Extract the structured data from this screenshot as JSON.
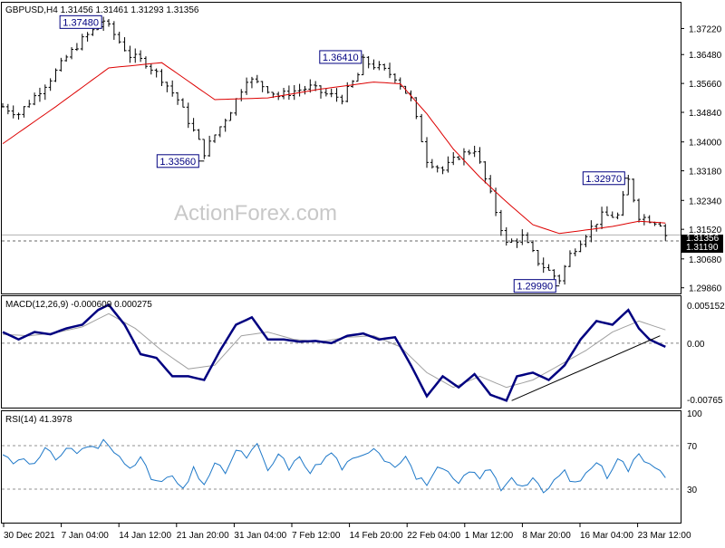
{
  "chart_data": [
    {
      "type": "ohlc",
      "panel": "price",
      "title": "GBPUSD,H4  1.31456 1.31461 1.31293 1.31356",
      "watermark": "ActionForex.com",
      "y_ticks": [
        1.3722,
        1.3648,
        1.3566,
        1.3484,
        1.34,
        1.3318,
        1.3234,
        1.3152,
        1.3068,
        1.2986
      ],
      "y_tick_labels": [
        "1.37220",
        "1.36480",
        "1.35660",
        "1.34840",
        "1.34000",
        "1.33180",
        "1.32340",
        "1.31520",
        "1.30680",
        "1.29860"
      ],
      "ylim": [
        1.2975,
        1.379
      ],
      "current_price": 1.3119,
      "current_price_label": "1.31190",
      "hidden_label": "1.31356",
      "annotations": [
        {
          "label": "1.37480",
          "x": 19,
          "y": 1.3748
        },
        {
          "label": "1.33560",
          "x": 38,
          "y": 1.3356
        },
        {
          "label": "1.36410",
          "x": 68,
          "y": 1.3641
        },
        {
          "label": "1.29990",
          "x": 105,
          "y": 1.2999
        },
        {
          "label": "1.32970",
          "x": 118,
          "y": 1.3297
        }
      ],
      "close_series": {
        "name": "",
        "x": [
          0,
          3,
          6,
          9,
          12,
          15,
          18,
          19,
          21,
          24,
          27,
          30,
          33,
          36,
          38,
          40,
          43,
          46,
          49,
          52,
          55,
          58,
          61,
          64,
          67,
          68,
          71,
          74,
          77,
          80,
          83,
          86,
          89,
          92,
          95,
          98,
          101,
          104,
          105,
          107,
          110,
          113,
          116,
          118,
          120,
          122,
          124,
          125
        ],
        "values": [
          1.35,
          1.348,
          1.353,
          1.358,
          1.364,
          1.369,
          1.3728,
          1.3745,
          1.3705,
          1.3645,
          1.3625,
          1.358,
          1.352,
          1.343,
          1.337,
          1.342,
          1.349,
          1.358,
          1.356,
          1.353,
          1.3545,
          1.3555,
          1.3535,
          1.3525,
          1.359,
          1.363,
          1.361,
          1.3585,
          1.352,
          1.335,
          1.332,
          1.336,
          1.338,
          1.325,
          1.311,
          1.313,
          1.306,
          1.302,
          1.301,
          1.308,
          1.314,
          1.319,
          1.319,
          1.329,
          1.319,
          1.318,
          1.317,
          1.3136
        ]
      },
      "ma_series": {
        "name": "",
        "x": [
          0,
          10,
          20,
          30,
          40,
          50,
          60,
          70,
          75,
          80,
          85,
          90,
          95,
          100,
          105,
          110,
          115,
          120,
          125
        ],
        "values": [
          1.3395,
          1.35,
          1.361,
          1.3625,
          1.352,
          1.3525,
          1.355,
          1.357,
          1.3565,
          1.348,
          1.338,
          1.33,
          1.323,
          1.3165,
          1.314,
          1.315,
          1.316,
          1.3175,
          1.317
        ]
      }
    },
    {
      "type": "line",
      "panel": "macd",
      "title": "MACD(12,26,9) -0.000609 0.000275",
      "y_tick_labels": [
        "0.005152",
        "0.00",
        "-0.00765"
      ],
      "y_ticks": [
        0.005152,
        0.0,
        -0.00765
      ],
      "ylim": [
        -0.0085,
        0.006
      ],
      "series": [
        {
          "name": "",
          "x": [
            0,
            3,
            6,
            9,
            12,
            15,
            18,
            20,
            23,
            26,
            29,
            32,
            35,
            38,
            41,
            44,
            47,
            50,
            53,
            56,
            59,
            62,
            65,
            68,
            71,
            74,
            77,
            80,
            83,
            86,
            89,
            92,
            95,
            97,
            100,
            103,
            106,
            109,
            112,
            115,
            118,
            120,
            122,
            125
          ],
          "values": [
            0.0015,
            0.0005,
            0.0015,
            0.0012,
            0.002,
            0.0025,
            0.0045,
            0.0052,
            0.0025,
            -0.0015,
            -0.002,
            -0.0045,
            -0.0045,
            -0.005,
            -0.001,
            0.0025,
            0.0035,
            0.0005,
            0.0005,
            0.0002,
            0.0003,
            0.0,
            0.001,
            0.0013,
            0.0005,
            0.0008,
            -0.003,
            -0.0072,
            -0.0045,
            -0.006,
            -0.0042,
            -0.007,
            -0.0078,
            -0.0045,
            -0.004,
            -0.005,
            -0.003,
            0.0005,
            0.003,
            0.0025,
            0.0045,
            0.002,
            0.0005,
            -0.0005
          ]
        },
        {
          "name": "",
          "x": [
            0,
            5,
            10,
            15,
            20,
            25,
            30,
            35,
            40,
            45,
            50,
            55,
            60,
            65,
            70,
            75,
            80,
            85,
            90,
            95,
            100,
            105,
            110,
            115,
            120,
            125
          ],
          "values": [
            0.0012,
            0.001,
            0.0014,
            0.0022,
            0.004,
            0.002,
            -0.001,
            -0.0035,
            -0.003,
            0.001,
            0.0015,
            0.0005,
            0.0002,
            0.0008,
            0.001,
            -0.0005,
            -0.004,
            -0.006,
            -0.0045,
            -0.006,
            -0.005,
            -0.003,
            -0.001,
            0.0015,
            0.003,
            0.0018
          ]
        }
      ],
      "trendline": {
        "x": [
          96,
          124
        ],
        "values": [
          -0.0078,
          0.001
        ]
      }
    },
    {
      "type": "line",
      "panel": "rsi",
      "title": "RSI(14) 41.3978",
      "y_tick_labels": [
        "100",
        "70",
        "30"
      ],
      "y_ticks": [
        100,
        70,
        30
      ],
      "levels": [
        70,
        30
      ],
      "ylim": [
        0,
        100
      ],
      "series": [
        {
          "name": "",
          "x": [
            0,
            2,
            4,
            6,
            8,
            10,
            12,
            14,
            16,
            18,
            19,
            20,
            22,
            24,
            26,
            28,
            30,
            32,
            34,
            36,
            38,
            40,
            42,
            44,
            46,
            48,
            50,
            52,
            54,
            56,
            58,
            60,
            62,
            64,
            66,
            68,
            70,
            72,
            74,
            76,
            78,
            80,
            82,
            84,
            86,
            88,
            90,
            92,
            94,
            96,
            98,
            100,
            102,
            104,
            106,
            108,
            110,
            112,
            114,
            116,
            118,
            120,
            122,
            124,
            125
          ],
          "values": [
            62,
            55,
            60,
            52,
            66,
            58,
            68,
            64,
            70,
            66,
            76,
            68,
            60,
            52,
            58,
            40,
            36,
            42,
            28,
            48,
            35,
            52,
            46,
            65,
            60,
            70,
            46,
            62,
            50,
            58,
            47,
            54,
            64,
            50,
            56,
            60,
            70,
            58,
            52,
            62,
            40,
            36,
            48,
            44,
            34,
            46,
            42,
            48,
            30,
            42,
            32,
            40,
            25,
            38,
            46,
            34,
            44,
            56,
            42,
            60,
            48,
            62,
            54,
            50,
            42
          ]
        }
      ]
    }
  ],
  "x_axis": {
    "tick_labels": [
      "30 Dec 2021",
      "7 Jan 04:00",
      "14 Jan 12:00",
      "21 Jan 20:00",
      "31 Jan 04:00",
      "7 Feb 12:00",
      "14 Feb 20:00",
      "22 Feb 04:00",
      "1 Mar 12:00",
      "8 Mar 20:00",
      "16 Mar 04:00",
      "23 Mar 12:00"
    ],
    "tick_x": [
      0,
      12,
      24,
      36,
      48,
      60,
      72,
      84,
      96,
      108,
      120,
      132
    ]
  },
  "colors": {
    "candle": "#000000",
    "ma": "#dd0000",
    "macd": "#000080",
    "signal": "#a0a0a0",
    "rsi": "#1e78c8",
    "grid_dash": "#9a9a9a",
    "annotation_border": "#000080",
    "price_badge": "#000000"
  }
}
